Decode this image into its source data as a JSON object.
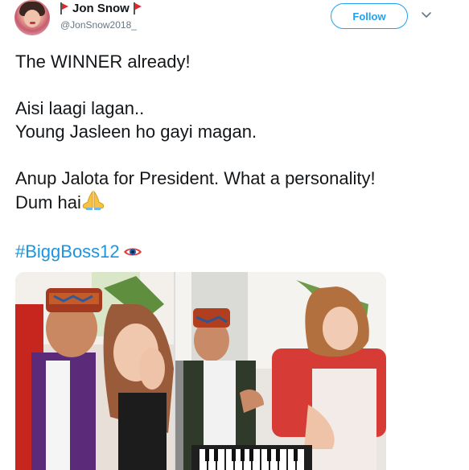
{
  "user": {
    "name": "Jon Snow",
    "handle": "@JonSnow2018_"
  },
  "actions": {
    "follow_label": "Follow"
  },
  "tweet": {
    "line1": "The WINNER already!",
    "line2": "Aisi laagi lagan..",
    "line3": "Young Jasleen ho gayi magan.",
    "line4": "Anup Jalota for President. What a personality!",
    "line5": "Dum hai",
    "hashtag": "#BiggBoss12"
  },
  "icons": {
    "flag": "triangular-red-flag-icon",
    "pray": "folded-hands-icon",
    "eye": "eye-icon",
    "chevron": "chevron-down-icon"
  },
  "colors": {
    "accent": "#1da1f2",
    "hashtag": "#1b95e0",
    "text": "#14171a",
    "muted": "#657786"
  }
}
